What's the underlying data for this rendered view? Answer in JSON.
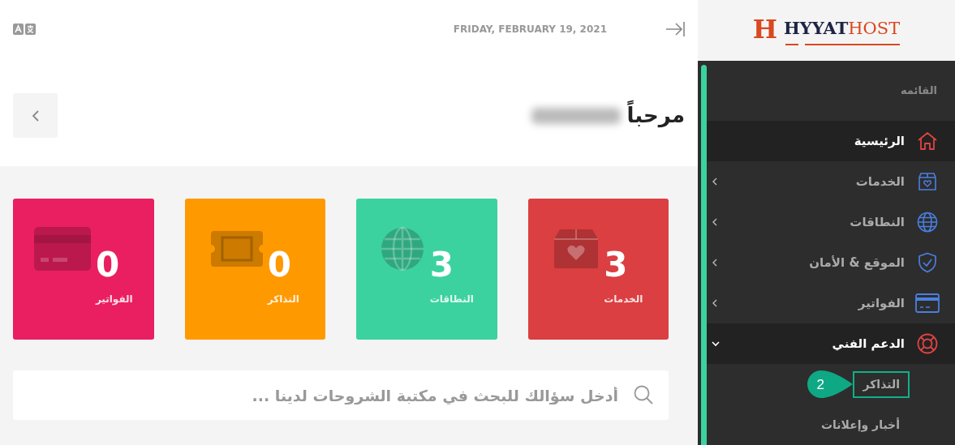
{
  "header": {
    "date": "FRIDAY, FEBRUARY 19, 2021"
  },
  "greeting": {
    "text": "مرحباً",
    "name_hidden": true
  },
  "stat_cards": [
    {
      "value": "3",
      "label": "الخدمات",
      "color": "#db3f41"
    },
    {
      "value": "3",
      "label": "النطاقات",
      "color": "#3bd29f"
    },
    {
      "value": "0",
      "label": "التذاكر",
      "color": "#ff9900"
    },
    {
      "value": "0",
      "label": "الفواتير",
      "color": "#ea1f62"
    }
  ],
  "search": {
    "placeholder": "أدخل سؤالك للبحث في مكتبة الشروحات لدينا ..."
  },
  "sidebar": {
    "logo": {
      "mark": "H",
      "name": "HYYAT",
      "suffix": "HOST"
    },
    "heading": "القائمه",
    "items": [
      {
        "label": "الرئيسية",
        "selected": true
      },
      {
        "label": "الخدمات",
        "selected": false,
        "expanded": false
      },
      {
        "label": "النطاقات",
        "selected": false,
        "expanded": false
      },
      {
        "label": "الموقع & الأمان",
        "selected": false,
        "expanded": false
      },
      {
        "label": "الفواتير",
        "selected": false,
        "expanded": false
      },
      {
        "label": "الدعم الفني",
        "selected": true,
        "expanded": true,
        "children": [
          {
            "label": "التذاكر",
            "highlighted": true,
            "callout": "2"
          },
          {
            "label": "أخبار وإعلانات",
            "highlighted": false
          }
        ]
      }
    ]
  }
}
